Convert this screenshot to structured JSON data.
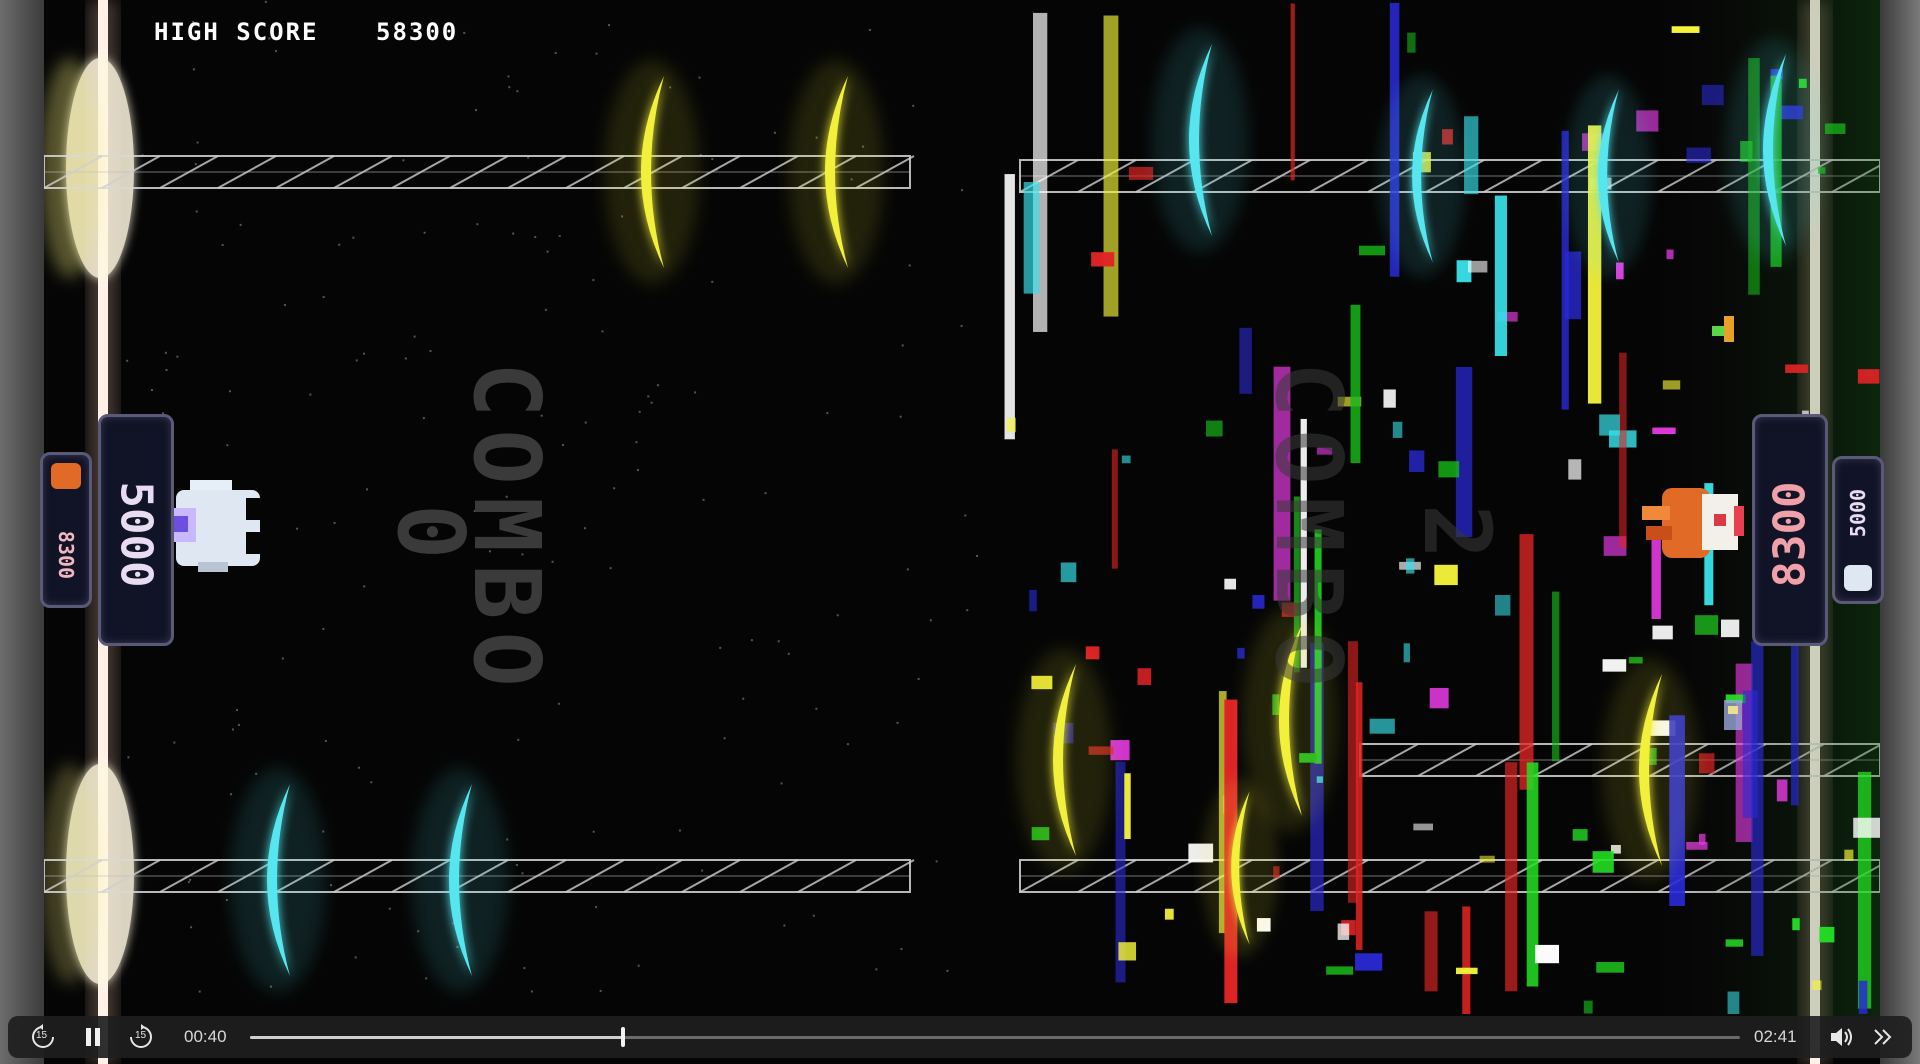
{
  "game": {
    "high_score_label": "HIGH SCORE",
    "high_score_value": "58300",
    "left_panel": {
      "combo_label": "COMBO",
      "combo_value": "0",
      "player_score": "5000",
      "rival_score": "8300"
    },
    "right_panel": {
      "player_score": "8300",
      "rival_score": "5000",
      "combo_value": "2"
    },
    "colors": {
      "yellow_note": "#f3f03a",
      "cyan_note": "#55e6f0",
      "rail": "#d8d8d8",
      "score_text_left": "#e8dcf0",
      "score_text_right": "#f0a0a8"
    }
  },
  "player_controls": {
    "rewind_icon": "rewind-15-icon",
    "rewind_label": "15",
    "pause_icon": "pause-icon",
    "forward_icon": "forward-15-icon",
    "forward_label": "15",
    "current_time": "00:40",
    "total_time": "02:41",
    "progress": 0.25,
    "volume_icon": "volume-icon",
    "more_icon": "chevrons-right-icon"
  }
}
